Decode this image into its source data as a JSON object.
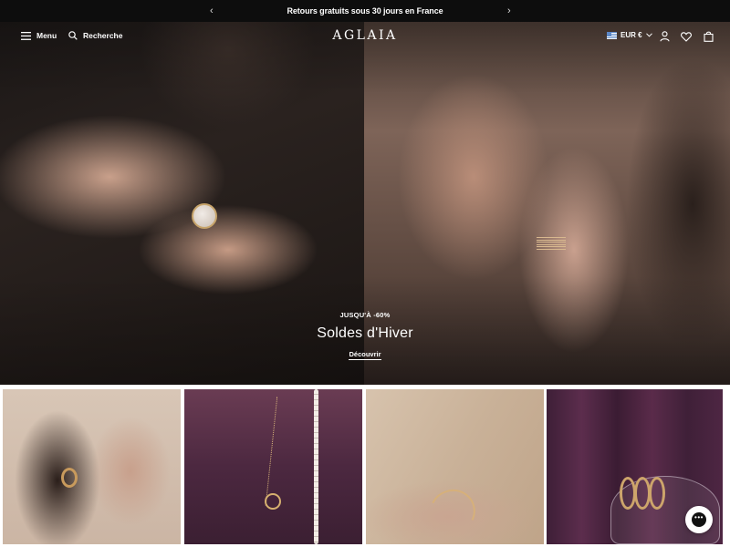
{
  "announcement": {
    "message": "Retours gratuits sous 30 jours en France",
    "prev_icon": "chevron-left-icon",
    "next_icon": "chevron-right-icon",
    "prev_glyph": "‹",
    "next_glyph": "›"
  },
  "header": {
    "menu_label": "Menu",
    "search_label": "Recherche",
    "logo_text": "AGLAIA",
    "currency": "EUR €",
    "icons": [
      "hamburger-icon",
      "search-icon",
      "flag-icon",
      "chevron-down-icon",
      "account-icon",
      "heart-icon",
      "bag-icon"
    ]
  },
  "hero": {
    "kicker": "JUSQU'À -60%",
    "title": "Soldes d'Hiver",
    "cta": "Découvrir"
  },
  "tiles": [
    {
      "subject": "earrings-portrait"
    },
    {
      "subject": "necklaces-velvet"
    },
    {
      "subject": "bracelets-wrist"
    },
    {
      "subject": "rings-glass-bowl"
    }
  ],
  "chat": {
    "glyph": "•••",
    "icon": "chat-icon"
  },
  "colors": {
    "announcement_bg": "#0d0d0d",
    "text_on_dark": "#ffffff",
    "accent_gold": "#d6b06f"
  }
}
